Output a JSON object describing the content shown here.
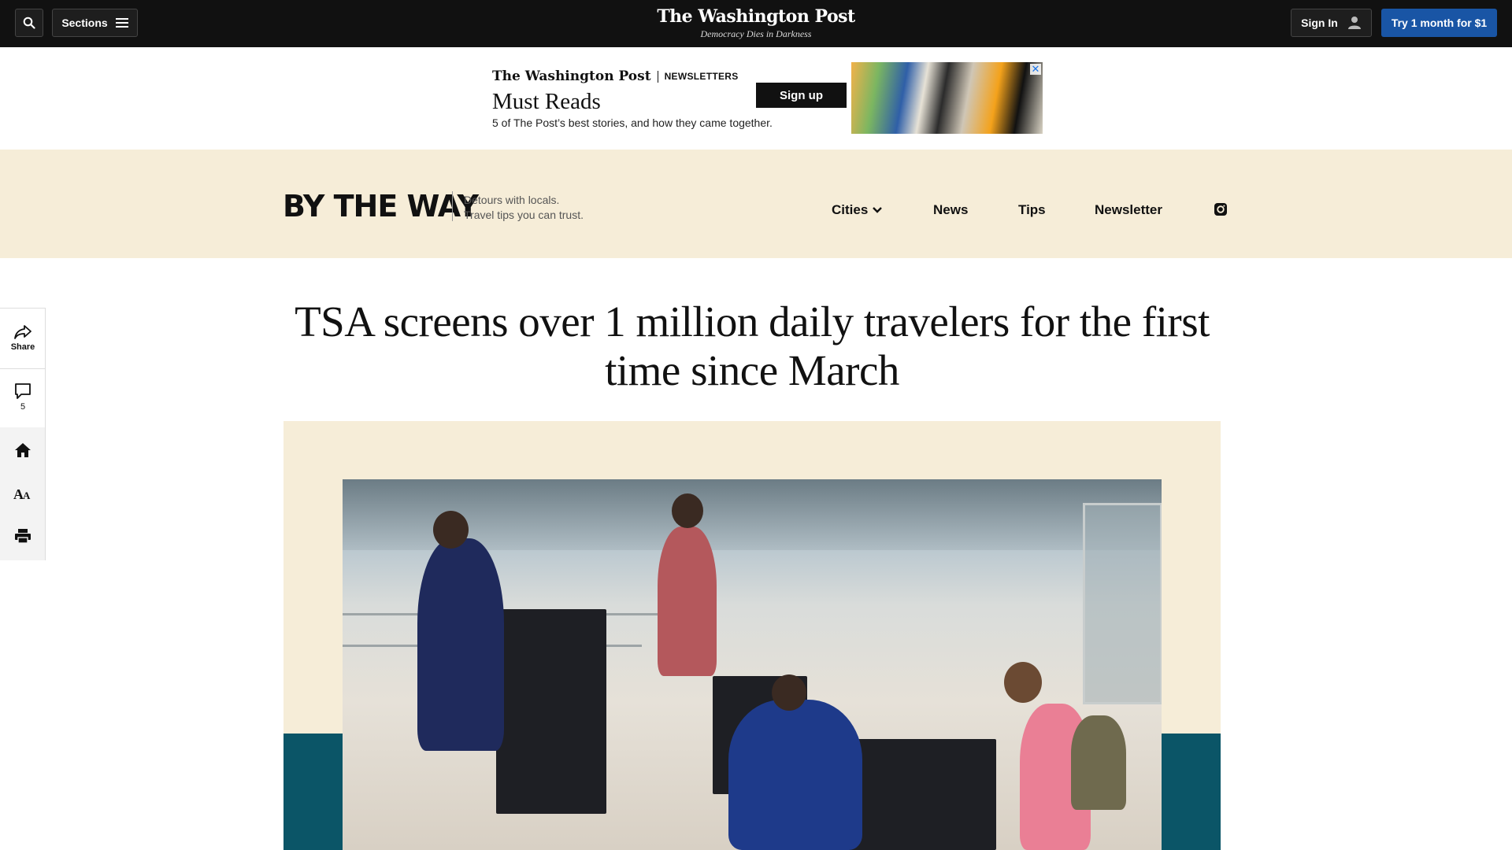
{
  "topbar": {
    "search_icon": "search-icon",
    "sections_label": "Sections",
    "masthead_name": "The Washington Post",
    "masthead_tagline": "Democracy Dies in Darkness",
    "signin_label": "Sign In",
    "subscribe_label": "Try 1 month for $1"
  },
  "ad": {
    "brand": "The Washington Post",
    "brand_label": "NEWSLETTERS",
    "title": "Must Reads",
    "description": "5 of The Post’s best stories, and how they came together.",
    "cta": "Sign up",
    "close": "✕"
  },
  "section": {
    "logo": "BY THE WAY",
    "tagline_line1": "Detours with locals.",
    "tagline_line2": "Travel tips you can trust.",
    "nav": {
      "cities": "Cities",
      "news": "News",
      "tips": "Tips",
      "newsletter": "Newsletter"
    }
  },
  "rail": {
    "share_label": "Share",
    "comments_count": "5"
  },
  "article": {
    "headline": "TSA screens over 1 million daily travelers for the first time since March"
  },
  "colors": {
    "topbar": "#111111",
    "subscribe": "#1955a5",
    "band": "#f6edd8",
    "teal": "#0b5567"
  }
}
